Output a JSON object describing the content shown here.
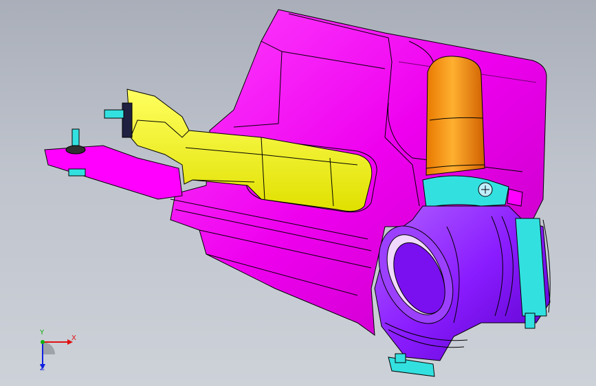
{
  "viewport": {
    "background_top": "#a9aeb9",
    "background_bottom": "#cdd1d8"
  },
  "model": {
    "parts": [
      {
        "name": "tank-body",
        "color": "#ff00ff"
      },
      {
        "name": "mounting-bracket",
        "color": "#ffff00"
      },
      {
        "name": "inlet-pipe",
        "color": "#ff9900"
      },
      {
        "name": "outlet-elbow",
        "color": "#8b1cff"
      },
      {
        "name": "hose-clamps",
        "color": "#33e0e0"
      }
    ]
  },
  "triad": {
    "x_label": "X",
    "y_label": "Y",
    "z_label": "Z",
    "x_color": "#e01010",
    "y_color": "#10b010",
    "z_color": "#1020e0"
  }
}
